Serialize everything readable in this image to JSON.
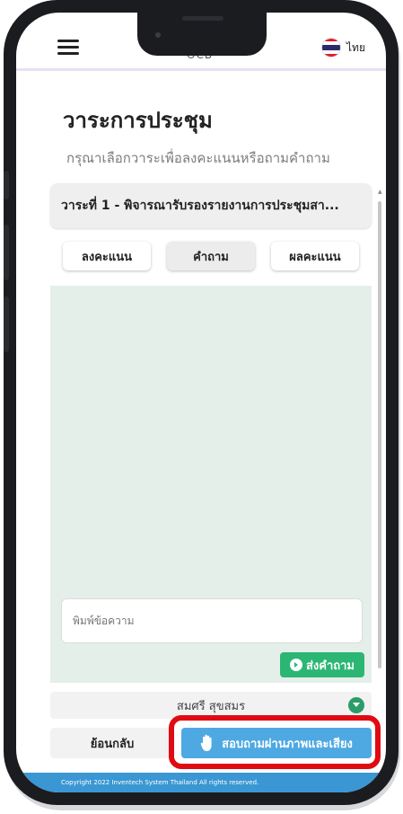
{
  "header": {
    "logo_text": "OCB",
    "language_label": "ไทย"
  },
  "page": {
    "title": "วาระการประชุม",
    "subtitle": "กรุณาเลือกวาระเพื่อลงคะแนนหรือถามคำถาม"
  },
  "agenda": {
    "selected": "วาระที่ 1 - พิจารณารับรองรายงานการประชุมสา..."
  },
  "tabs": [
    {
      "label": "ลงคะแนน"
    },
    {
      "label": "คำถาม"
    },
    {
      "label": "ผลคะแนน"
    }
  ],
  "question_panel": {
    "input_placeholder": "พิมพ์ข้อความ",
    "send_label": "ส่งคำถาม"
  },
  "user": {
    "name": "สมศรี สุขสมร"
  },
  "actions": {
    "back_label": "ย้อนกลับ",
    "video_label": "สอบถามผ่านภาพและเสียง"
  },
  "footer": {
    "copyright": "Copyright 2022 Inventech System Thailand All rights reserved."
  },
  "colors": {
    "send_green": "#2bb673",
    "video_blue": "#4ea9e3",
    "highlight_red": "#e00b12",
    "footer_blue": "#3a97d3",
    "panel_bg": "#e5efe9"
  }
}
